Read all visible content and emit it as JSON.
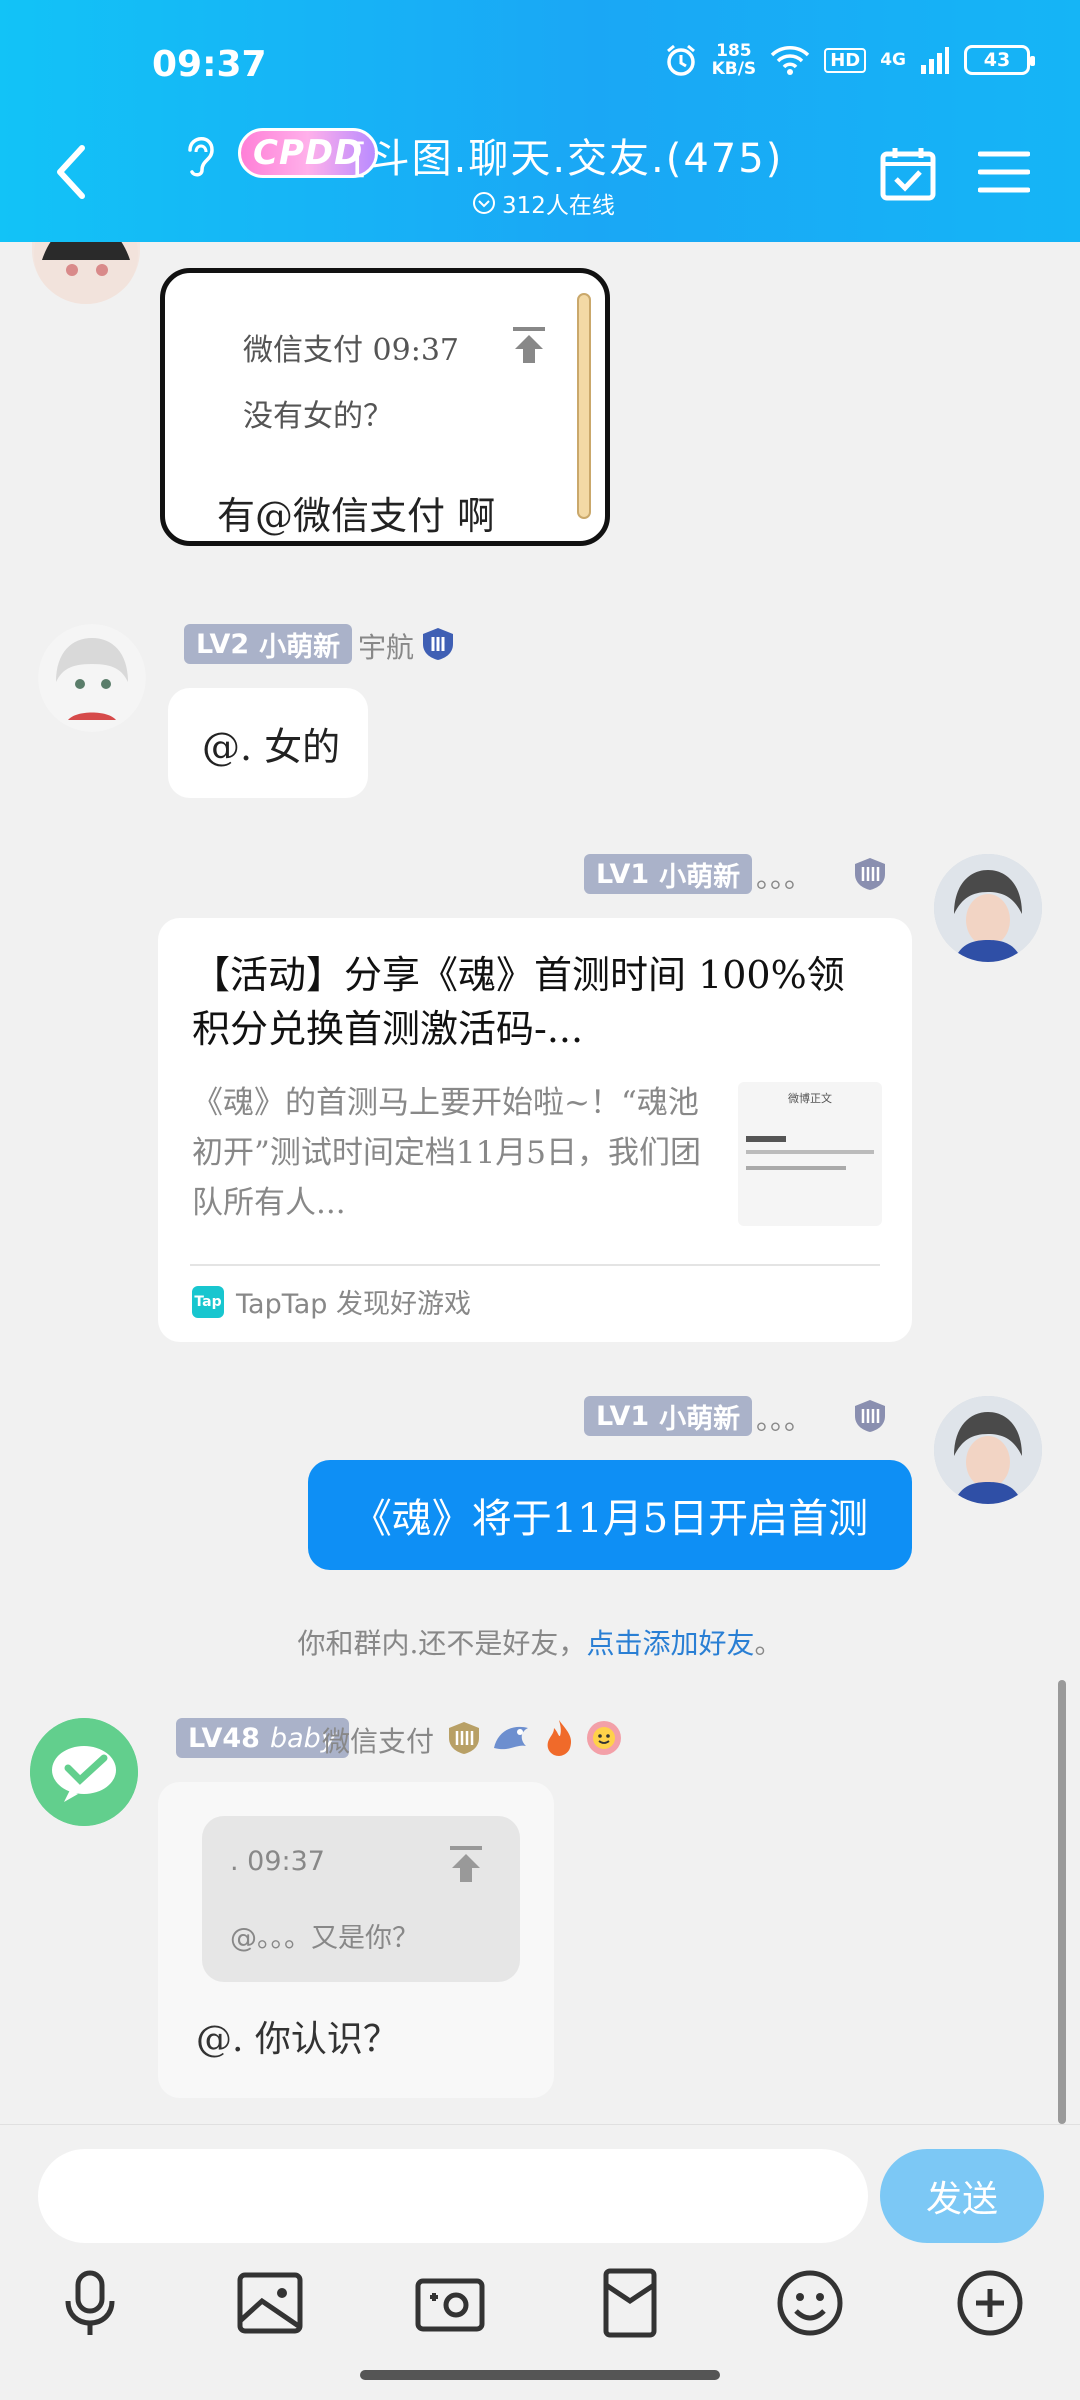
{
  "status_bar": {
    "time": "09:37",
    "net_speed": "185",
    "net_unit": "KB/S",
    "hd": "HD",
    "network": "4G",
    "battery": "43"
  },
  "header": {
    "badge": "CPDD",
    "title": "[斗图.聊天.交友.(475)",
    "online": "312人在线"
  },
  "messages": {
    "m1": {
      "quote_sender": "微信支付 09:37",
      "quote_text": "没有女的？",
      "text": "有@微信支付 啊"
    },
    "m2": {
      "level": "LV2",
      "title": "小萌新",
      "nick": "宇航",
      "text": "@. 女的"
    },
    "m3": {
      "level": "LV1",
      "title": "小萌新",
      "nick": "。。。",
      "card_title": "【活动】分享《魂》首测时间 100%领积分兑换首测激活码-...",
      "card_desc": "《魂》的首测马上要开始啦~！“魂池初开”测试时间定档11月5日，我们团队所有人...",
      "thumb_title": "微博正文",
      "source": "TapTap 发现好游戏",
      "source_logo": "Tap"
    },
    "m4": {
      "level": "LV1",
      "title": "小萌新",
      "nick": "。。。",
      "text": "《魂》将于11月5日开启首测"
    },
    "notice": {
      "prefix": "你和群内.还不是好友，",
      "link": "点击添加好友",
      "suffix": "。"
    },
    "m5": {
      "level": "LV48",
      "title": "baby",
      "nick": "微信支付",
      "quote_sender": ". 09:37",
      "quote_text": "@。。。又是你？",
      "text": "@. 你认识？"
    }
  },
  "input": {
    "placeholder": "",
    "send_label": "发送"
  },
  "colors": {
    "header": "#15b5f6",
    "sent_bubble": "#0e8ff5",
    "send_button": "#7cc8f5",
    "badge": "#aab2c9"
  }
}
